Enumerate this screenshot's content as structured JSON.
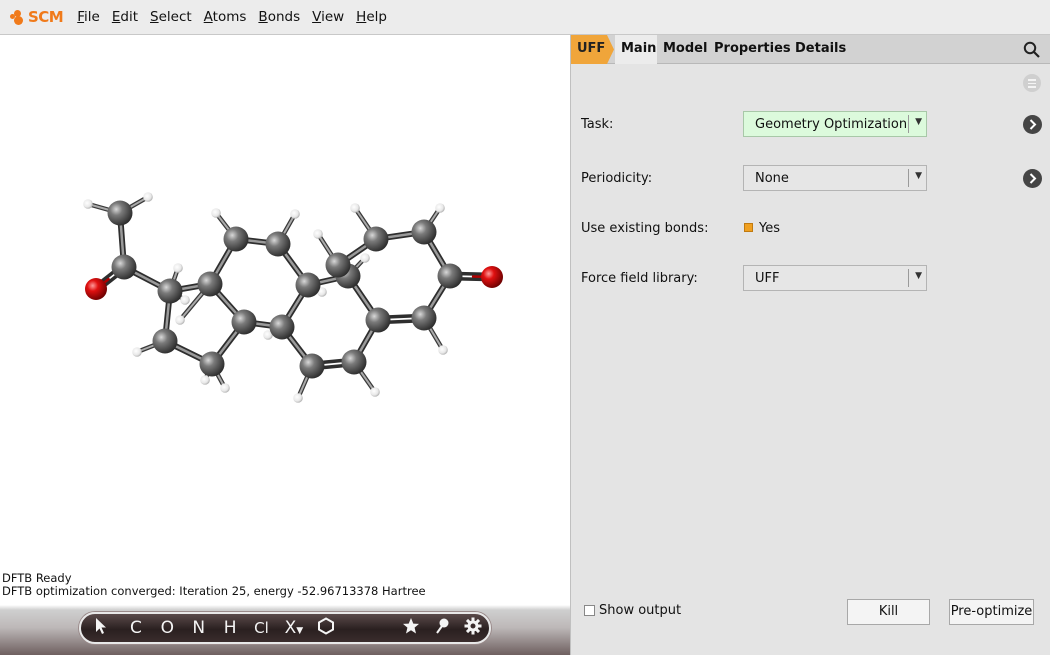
{
  "menubar": {
    "brand": "SCM",
    "items": [
      {
        "accel": "F",
        "rest": "ile"
      },
      {
        "accel": "E",
        "rest": "dit"
      },
      {
        "accel": "S",
        "rest": "elect"
      },
      {
        "accel": "A",
        "rest": "toms"
      },
      {
        "accel": "B",
        "rest": "onds"
      },
      {
        "accel": "V",
        "rest": "iew"
      },
      {
        "accel": "H",
        "rest": "elp"
      }
    ]
  },
  "status": {
    "line1": "DFTB Ready",
    "line2": "DFTB optimization converged: Iteration 25, energy -52.96713378 Hartree"
  },
  "toolbar": {
    "tools": [
      "C",
      "O",
      "N",
      "H",
      "Cl",
      "X"
    ]
  },
  "panel": {
    "engine_tab": "UFF",
    "tabs": [
      "Main",
      "Model",
      "Properties",
      "Details"
    ],
    "active_tab": "Main",
    "task_label": "Task:",
    "task_value": "Geometry Optimization",
    "periodicity_label": "Periodicity:",
    "periodicity_value": "None",
    "bonds_label": "Use existing bonds:",
    "bonds_value": "Yes",
    "ff_label": "Force field library:",
    "ff_value": "UFF",
    "show_output": "Show output",
    "kill": "Kill",
    "preoptimize": "Pre-optimize"
  },
  "colors": {
    "accent": "#f07a1a",
    "engine_tab": "#f0a53a",
    "task_combo": "#dcfadc",
    "carbon": "#5a5a5a",
    "oxygen": "#e01818",
    "hydrogen": "#f2f2f2"
  }
}
